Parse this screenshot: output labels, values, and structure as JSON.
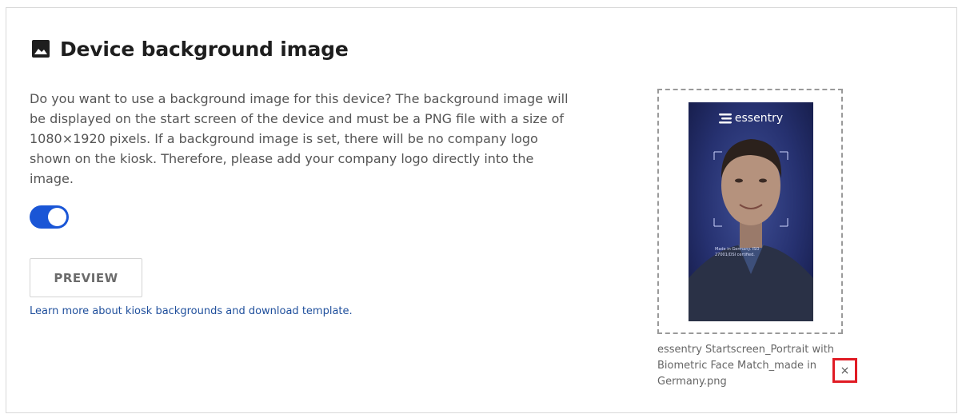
{
  "section": {
    "title": "Device background image",
    "title_icon": "image-icon",
    "description": "Do you want to use a background image for this device? The background image will be displayed on the start screen of the device and must be a PNG file with a size of 1080×1920 pixels. If a background image is set, there will be no company logo shown on the kiosk. Therefore, please add your company logo directly into the image."
  },
  "toggle": {
    "state": "on",
    "color": "#1a56d6"
  },
  "preview_button": {
    "label": "PREVIEW"
  },
  "learn_link": {
    "label": "Learn more about kiosk backgrounds and download template."
  },
  "upload": {
    "thumbnail_brand": "essentry",
    "thumbnail_caption": "Made in Germany. ISO 27001/DSI certified.",
    "file_name": "essentry Startscreen_Portrait with Biometric Face Match_made in Germany.png",
    "remove_label": "×",
    "remove_highlight_color": "#e01b24"
  }
}
